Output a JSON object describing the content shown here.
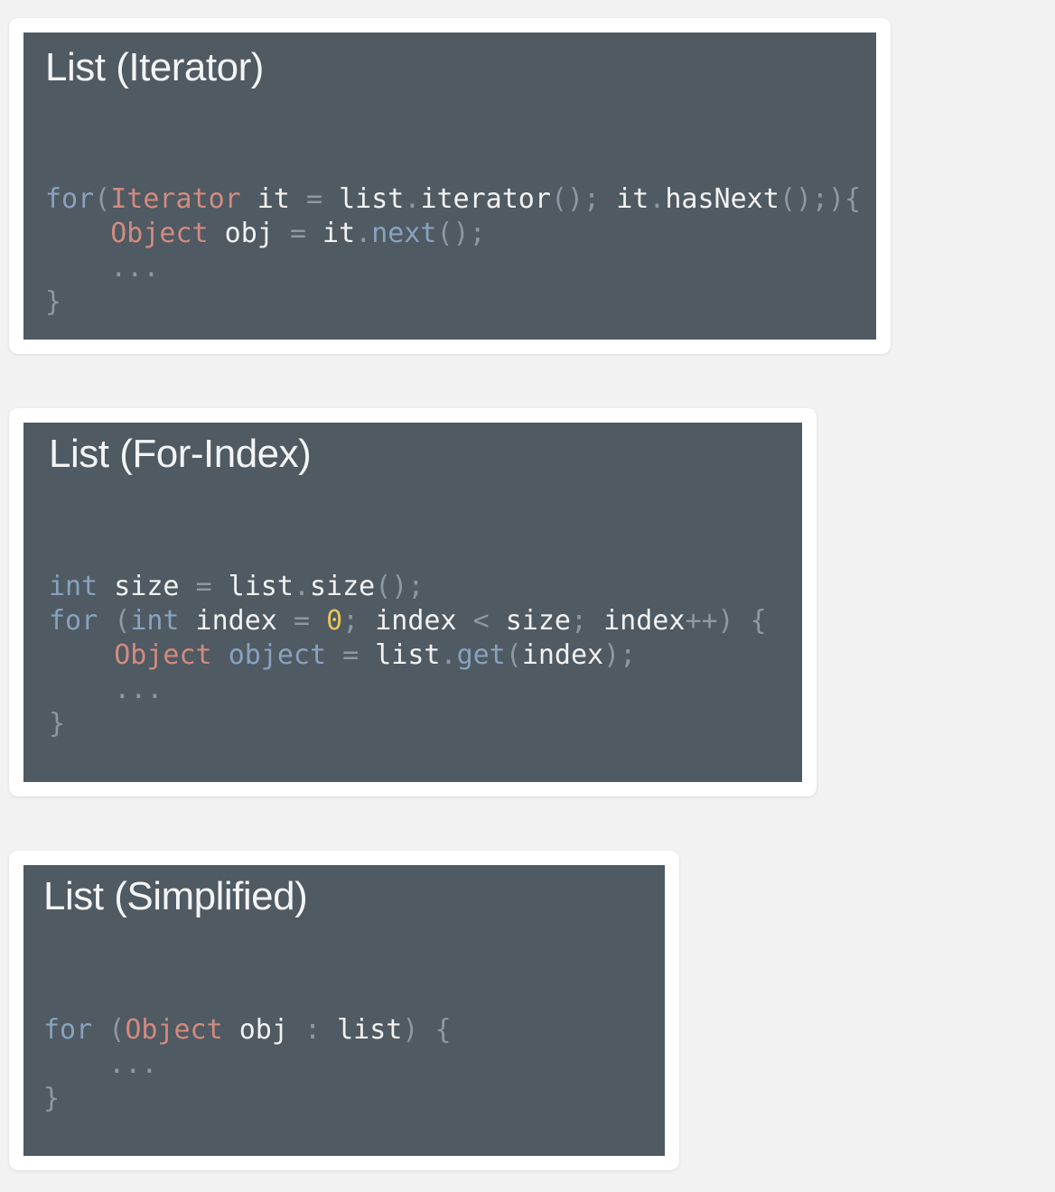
{
  "slides": [
    {
      "title": "List (Iterator)",
      "code": [
        [
          {
            "t": "for",
            "c": "kw"
          },
          {
            "t": "(",
            "c": "punc"
          },
          {
            "t": "Iterator",
            "c": "type"
          },
          {
            "t": " it ",
            "c": "id"
          },
          {
            "t": "=",
            "c": "punc"
          },
          {
            "t": " list",
            "c": "id"
          },
          {
            "t": ".",
            "c": "punc"
          },
          {
            "t": "iterator",
            "c": "id"
          },
          {
            "t": "(); ",
            "c": "punc"
          },
          {
            "t": "it",
            "c": "id"
          },
          {
            "t": ".",
            "c": "punc"
          },
          {
            "t": "hasNext",
            "c": "id"
          },
          {
            "t": "();){",
            "c": "punc"
          }
        ],
        [
          {
            "t": "    ",
            "c": "id"
          },
          {
            "t": "Object",
            "c": "type"
          },
          {
            "t": " obj ",
            "c": "id"
          },
          {
            "t": "=",
            "c": "punc"
          },
          {
            "t": " it",
            "c": "id"
          },
          {
            "t": ".",
            "c": "punc"
          },
          {
            "t": "next",
            "c": "kw"
          },
          {
            "t": "();",
            "c": "punc"
          }
        ],
        [
          {
            "t": "    ",
            "c": "id"
          },
          {
            "t": "...",
            "c": "punc"
          }
        ],
        [
          {
            "t": "}",
            "c": "punc"
          }
        ]
      ]
    },
    {
      "title": "List (For-Index)",
      "code": [
        [
          {
            "t": "int",
            "c": "kw"
          },
          {
            "t": " size ",
            "c": "id"
          },
          {
            "t": "=",
            "c": "punc"
          },
          {
            "t": " list",
            "c": "id"
          },
          {
            "t": ".",
            "c": "punc"
          },
          {
            "t": "size",
            "c": "id"
          },
          {
            "t": "();",
            "c": "punc"
          }
        ],
        [
          {
            "t": "for",
            "c": "kw"
          },
          {
            "t": " (",
            "c": "punc"
          },
          {
            "t": "int",
            "c": "kw"
          },
          {
            "t": " index ",
            "c": "id"
          },
          {
            "t": "=",
            "c": "punc"
          },
          {
            "t": " ",
            "c": "id"
          },
          {
            "t": "0",
            "c": "num"
          },
          {
            "t": ";",
            "c": "punc"
          },
          {
            "t": " index ",
            "c": "id"
          },
          {
            "t": "<",
            "c": "punc"
          },
          {
            "t": " size",
            "c": "id"
          },
          {
            "t": ";",
            "c": "punc"
          },
          {
            "t": " index",
            "c": "id"
          },
          {
            "t": "++) {",
            "c": "punc"
          }
        ],
        [
          {
            "t": "    ",
            "c": "id"
          },
          {
            "t": "Object",
            "c": "type"
          },
          {
            "t": " ",
            "c": "id"
          },
          {
            "t": "object",
            "c": "kw"
          },
          {
            "t": " ",
            "c": "id"
          },
          {
            "t": "=",
            "c": "punc"
          },
          {
            "t": " list",
            "c": "id"
          },
          {
            "t": ".",
            "c": "punc"
          },
          {
            "t": "get",
            "c": "kw"
          },
          {
            "t": "(",
            "c": "punc"
          },
          {
            "t": "index",
            "c": "id"
          },
          {
            "t": ");",
            "c": "punc"
          }
        ],
        [
          {
            "t": "    ",
            "c": "id"
          },
          {
            "t": "...",
            "c": "punc"
          }
        ],
        [
          {
            "t": "}",
            "c": "punc"
          }
        ]
      ]
    },
    {
      "title": "List (Simplified)",
      "code": [
        [
          {
            "t": "for",
            "c": "kw"
          },
          {
            "t": " (",
            "c": "punc"
          },
          {
            "t": "Object",
            "c": "type"
          },
          {
            "t": " obj ",
            "c": "id"
          },
          {
            "t": ":",
            "c": "punc"
          },
          {
            "t": " list",
            "c": "id"
          },
          {
            "t": ") {",
            "c": "punc"
          }
        ],
        [
          {
            "t": "    ",
            "c": "id"
          },
          {
            "t": "...",
            "c": "punc"
          }
        ],
        [
          {
            "t": "}",
            "c": "punc"
          }
        ]
      ]
    }
  ]
}
